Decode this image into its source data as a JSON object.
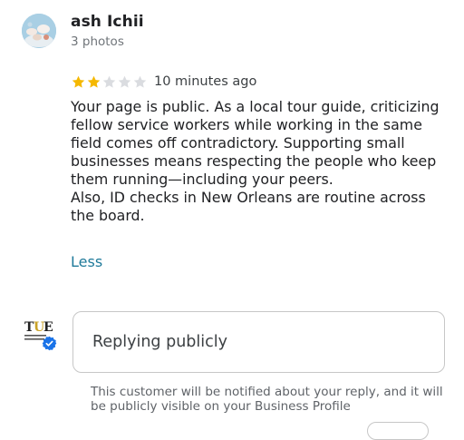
{
  "reviewer": {
    "name": "ash Ichii",
    "photos": "3 photos",
    "avatar_icon": "reviewer-avatar-icon"
  },
  "review": {
    "rating": 2,
    "max_rating": 5,
    "time_ago": "10 minutes ago",
    "paragraphs": [
      "Your page is public. As a local tour guide, criticizing fellow service workers while working in the same field comes off contradictory. Supporting small businesses means respecting the people who keep them running—including your peers.",
      "Also, ID checks in New Orleans are routine across the board."
    ],
    "less_label": "Less"
  },
  "reply": {
    "placeholder": "Replying publicly",
    "notice": "This customer will be notified about your reply, and it will be publicly visible on your Business Profile",
    "business_logo_icon": "business-logo-icon",
    "verified_icon": "verified-badge-icon"
  },
  "colors": {
    "star_filled": "#f5b800",
    "star_empty": "#dadce0",
    "link": "#1f7a9a",
    "verified": "#1a73e8"
  }
}
